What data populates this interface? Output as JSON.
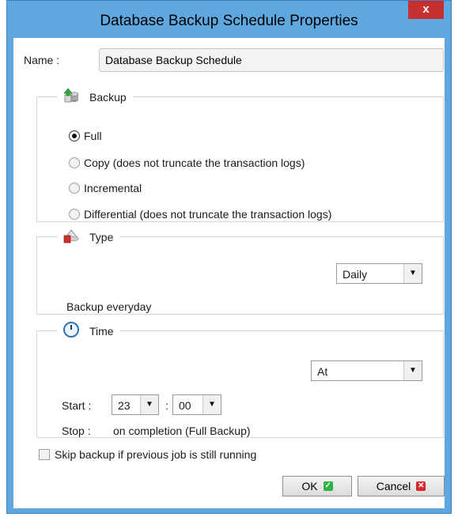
{
  "window": {
    "title": "Database Backup Schedule Properties",
    "close_glyph": "x"
  },
  "name": {
    "label": "Name :",
    "value": "Database Backup Schedule"
  },
  "backup": {
    "legend": "Backup",
    "icon": "database-backup-icon",
    "options": [
      {
        "label": "Full",
        "selected": true
      },
      {
        "label": "Copy (does not truncate the transaction logs)",
        "selected": false
      },
      {
        "label": "Incremental",
        "selected": false
      },
      {
        "label": "Differential (does not truncate the transaction logs)",
        "selected": false
      }
    ]
  },
  "type": {
    "legend": "Type",
    "icon": "schedule-type-icon",
    "selected": "Daily",
    "description": "Backup everyday"
  },
  "time": {
    "legend": "Time",
    "icon": "clock-icon",
    "mode": "At",
    "start_label": "Start :",
    "start_hour": "23",
    "separator": ":",
    "start_minute": "00",
    "stop_label": "Stop :",
    "stop_value": "on completion (Full Backup)"
  },
  "skip": {
    "label": "Skip backup if previous job is still running",
    "checked": false
  },
  "buttons": {
    "ok": "OK",
    "cancel": "Cancel"
  },
  "colors": {
    "title_bar": "#5fa7df",
    "close": "#c7302f",
    "ok_icon": "#2fb342",
    "cancel_icon": "#d9262a"
  }
}
